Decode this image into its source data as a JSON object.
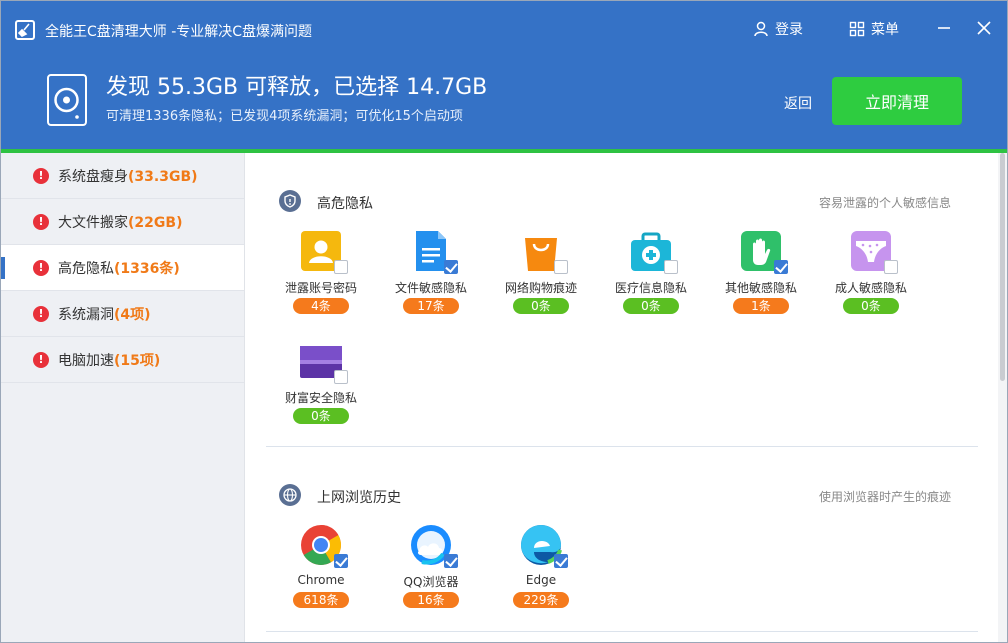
{
  "app": {
    "title": "全能王C盘清理大师 -专业解决C盘爆满问题",
    "login": "登录",
    "menu": "菜单"
  },
  "summary": {
    "title": "发现 55.3GB 可释放，已选择 14.7GB",
    "subtitle": "可清理1336条隐私；已发现4项系统漏洞；可优化15个启动项",
    "back": "返回",
    "clean_button": "立即清理"
  },
  "sidebar": {
    "items": [
      {
        "label": "系统盘瘦身",
        "open": "(",
        "count": "33.3GB",
        "close": ")"
      },
      {
        "label": "大文件搬家",
        "open": "(",
        "count": "22GB",
        "close": ")"
      },
      {
        "label": "高危隐私",
        "open": "(",
        "count": "1336条",
        "close": ")"
      },
      {
        "label": "系统漏洞",
        "open": "(",
        "count": "4项",
        "close": ")"
      },
      {
        "label": "电脑加速",
        "open": "(",
        "count": "15项",
        "close": ")"
      }
    ]
  },
  "sections": {
    "privacy": {
      "title": "高危隐私",
      "hint": "容易泄露的个人敏感信息",
      "items": [
        {
          "name": "泄露账号密码",
          "count": "4条",
          "checked": false,
          "icon": "id-card-icon"
        },
        {
          "name": "文件敏感隐私",
          "count": "17条",
          "checked": true,
          "icon": "document-icon"
        },
        {
          "name": "网络购物痕迹",
          "count": "0条",
          "checked": false,
          "icon": "shopping-bag-icon"
        },
        {
          "name": "医疗信息隐私",
          "count": "0条",
          "checked": false,
          "icon": "medical-kit-icon"
        },
        {
          "name": "其他敏感隐私",
          "count": "1条",
          "checked": true,
          "icon": "hand-icon"
        },
        {
          "name": "成人敏感隐私",
          "count": "0条",
          "checked": false,
          "icon": "underwear-icon"
        },
        {
          "name": "财富安全隐私",
          "count": "0条",
          "checked": false,
          "icon": "wallet-card-icon"
        }
      ]
    },
    "browser": {
      "title": "上网浏览历史",
      "hint": "使用浏览器时产生的痕迹",
      "items": [
        {
          "name": "Chrome",
          "count": "618条",
          "checked": true,
          "icon": "chrome-icon"
        },
        {
          "name": "QQ浏览器",
          "count": "16条",
          "checked": true,
          "icon": "qq-browser-icon"
        },
        {
          "name": "Edge",
          "count": "229条",
          "checked": true,
          "icon": "edge-icon"
        }
      ]
    }
  },
  "colors": {
    "header": "#3572c6",
    "accent_green": "#2ecc40",
    "count_orange": "#f07a18",
    "badge_orange": "#f57a1c",
    "badge_green": "#5bbf22"
  }
}
